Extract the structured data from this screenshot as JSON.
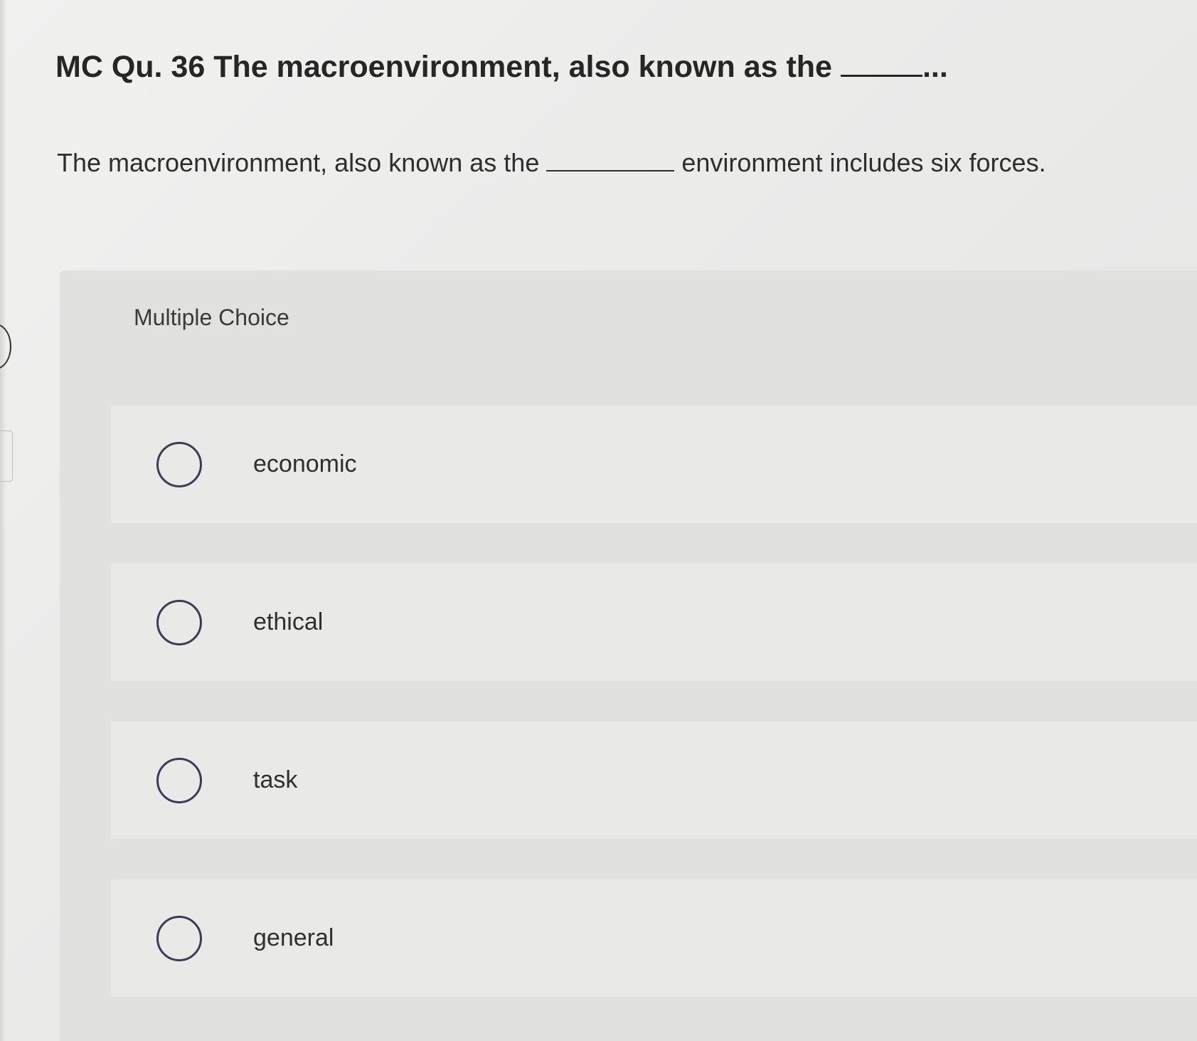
{
  "question": {
    "header_text": "MC Qu. 36 The macroenvironment, also known as the",
    "header_ellipsis": "...",
    "text_before_blank": "The macroenvironment, also known as the",
    "text_after_blank": "environment includes six forces."
  },
  "multiple_choice": {
    "title": "Multiple Choice",
    "options": [
      {
        "label": "economic"
      },
      {
        "label": "ethical"
      },
      {
        "label": "task"
      },
      {
        "label": "general"
      }
    ]
  },
  "colors": {
    "radio_border": "#3f3a55",
    "panel_background": "#e1e1e0",
    "option_background": "#e9e9e8"
  }
}
